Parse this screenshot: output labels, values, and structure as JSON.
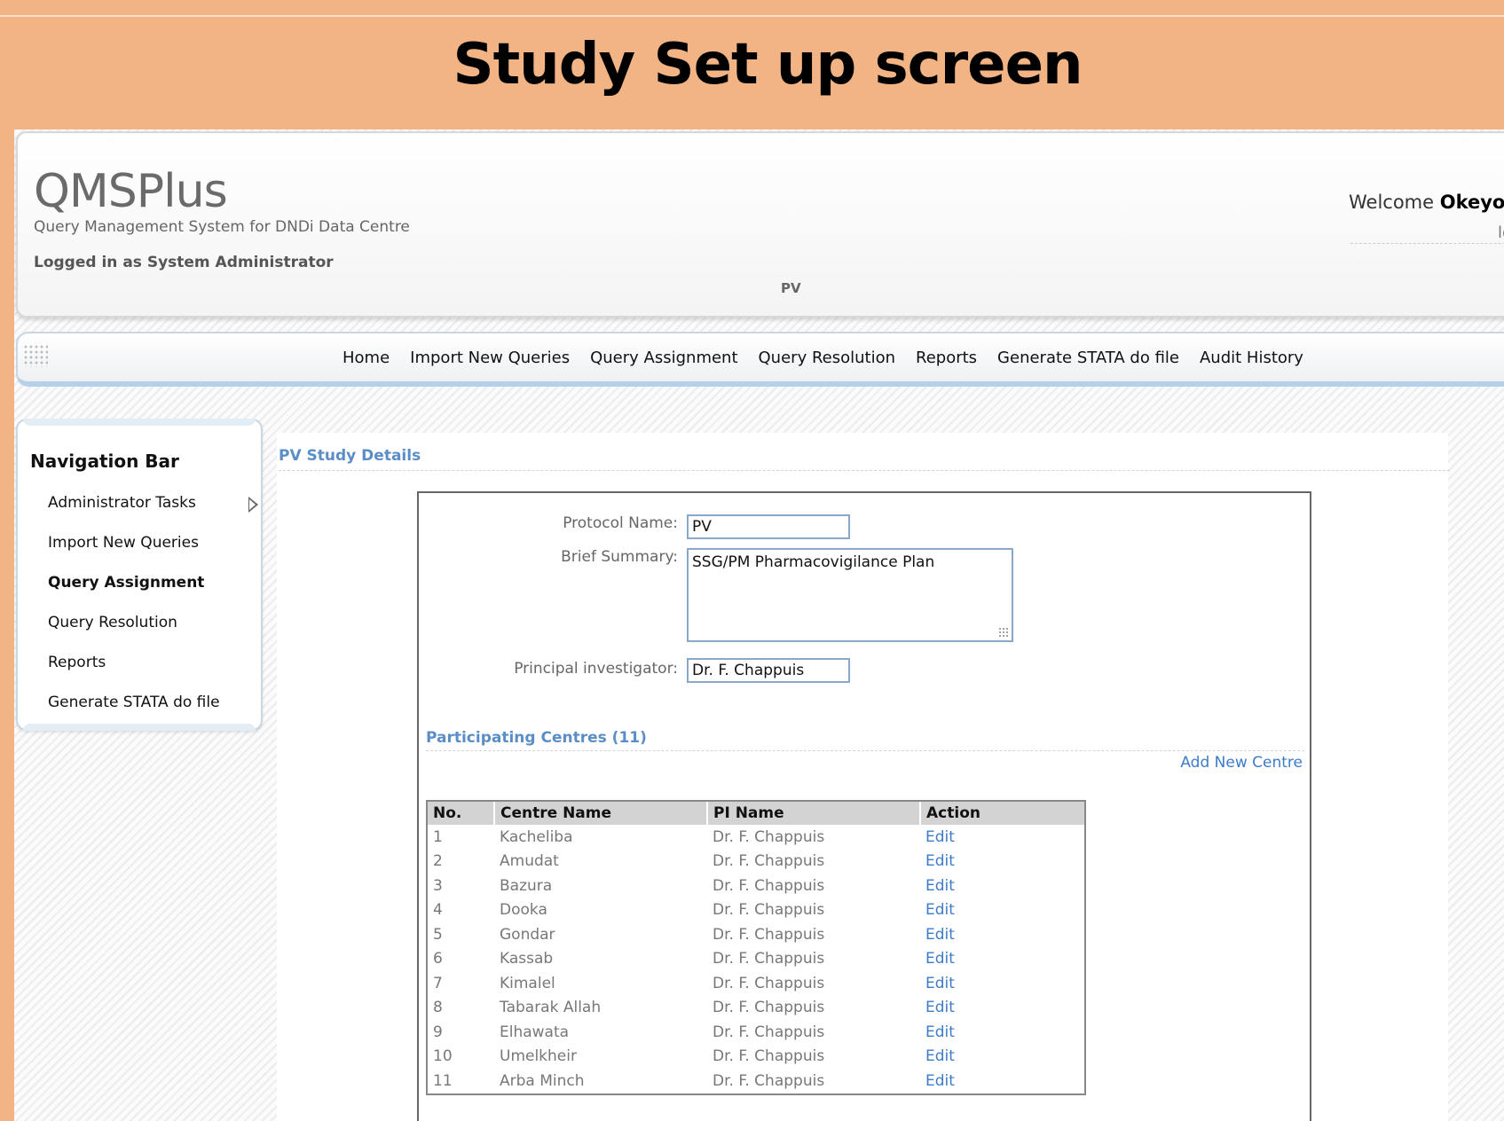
{
  "slide": {
    "title": "Study Set up screen"
  },
  "header": {
    "logo": "QMSPlus",
    "subtitle": "Query Management System for DNDi Data Centre",
    "logged_in": "Logged in as System Administrator",
    "study_code": "PV",
    "welcome_prefix": "Welcome ",
    "welcome_user": "Okeyo,S",
    "logout_fragment": "lo"
  },
  "topnav": {
    "items": [
      "Home",
      "Import New Queries",
      "Query Assignment",
      "Query Resolution",
      "Reports",
      "Generate STATA do file",
      "Audit History"
    ]
  },
  "sidebar": {
    "title": "Navigation Bar",
    "items": [
      {
        "label": "Administrator Tasks"
      },
      {
        "label": "Import New Queries"
      },
      {
        "label": "Query Assignment",
        "active": true
      },
      {
        "label": "Query Resolution"
      },
      {
        "label": "Reports"
      },
      {
        "label": "Generate STATA do file"
      }
    ]
  },
  "details": {
    "title": "PV Study Details",
    "protocol_label": "Protocol Name:",
    "protocol_value": "PV",
    "summary_label": "Brief Summary:",
    "summary_value": "SSG/PM Pharmacovigilance Plan",
    "pi_label": "Principal investigator:",
    "pi_value": "Dr. F. Chappuis"
  },
  "centres": {
    "title": "Participating Centres (11)",
    "add_label": "Add New Centre",
    "columns": [
      "No.",
      "Centre Name",
      "PI Name",
      "Action"
    ],
    "rows": [
      [
        "1",
        "Kacheliba",
        "Dr. F. Chappuis",
        "Edit"
      ],
      [
        "2",
        "Amudat",
        "Dr. F. Chappuis",
        "Edit"
      ],
      [
        "3",
        "Bazura",
        "Dr. F. Chappuis",
        "Edit"
      ],
      [
        "4",
        "Dooka",
        "Dr. F. Chappuis",
        "Edit"
      ],
      [
        "5",
        "Gondar",
        "Dr. F. Chappuis",
        "Edit"
      ],
      [
        "6",
        "Kassab",
        "Dr. F. Chappuis",
        "Edit"
      ],
      [
        "7",
        "Kimalel",
        "Dr. F. Chappuis",
        "Edit"
      ],
      [
        "8",
        "Tabarak Allah",
        "Dr. F. Chappuis",
        "Edit"
      ],
      [
        "9",
        "Elhawata",
        "Dr. F. Chappuis",
        "Edit"
      ],
      [
        "10",
        "Umelkheir",
        "Dr. F. Chappuis",
        "Edit"
      ],
      [
        "11",
        "Arba Minch",
        "Dr. F. Chappuis",
        "Edit"
      ]
    ]
  }
}
